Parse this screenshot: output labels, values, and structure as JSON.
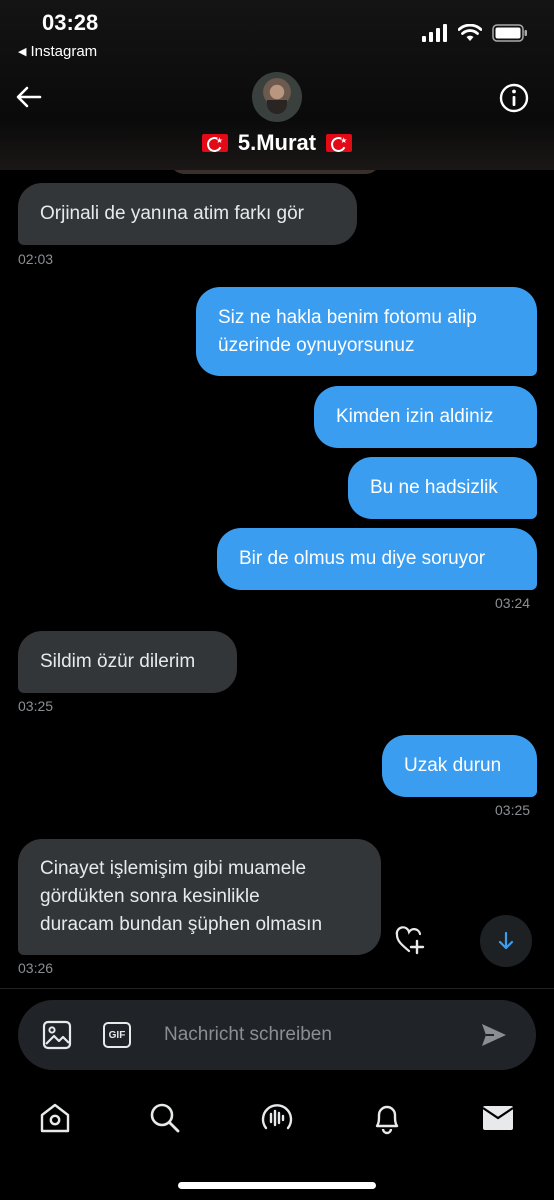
{
  "status_bar": {
    "time": "03:28",
    "back_app": "Instagram",
    "icons": [
      "signal-icon",
      "wifi-icon",
      "battery-icon"
    ]
  },
  "header": {
    "name": "5.Murat",
    "flag_emoji": "turkey-flag",
    "back_icon": "arrow-left-icon",
    "info_icon": "info-icon"
  },
  "messages": [
    {
      "direction": "in",
      "lines": [
        "Orjinali de yanına atim farkı gör"
      ]
    },
    {
      "direction": "out",
      "lines": [
        "Siz ne hakla benim fotomu alip",
        "üzerinde oynuyorsunuz"
      ]
    },
    {
      "direction": "out",
      "lines": [
        "Kimden izin aldiniz"
      ]
    },
    {
      "direction": "out",
      "lines": [
        "Bu ne hadsizlik"
      ]
    },
    {
      "direction": "out",
      "lines": [
        "Bir de olmus mu diye soruyor"
      ]
    },
    {
      "direction": "in",
      "lines": [
        "Sildim özür dilerim"
      ]
    },
    {
      "direction": "out",
      "lines": [
        "Uzak durun"
      ]
    },
    {
      "direction": "in",
      "lines": [
        "Cinayet işlemişim gibi muamele",
        "gördükten sonra kesinlikle",
        "duracam bundan şüphen olmasın"
      ]
    }
  ],
  "timestamps": [
    "02:03",
    "03:24",
    "03:25",
    "03:25",
    "03:26"
  ],
  "composer": {
    "placeholder": "Nachricht schreiben",
    "image_icon": "image-icon",
    "gif_label": "GIF",
    "send_icon": "send-icon"
  },
  "nav": [
    "home-icon",
    "search-icon",
    "spaces-icon",
    "bell-icon",
    "mail-icon"
  ],
  "colors": {
    "outgoing": "#3b9df0",
    "incoming": "#333639",
    "background": "#000000"
  }
}
